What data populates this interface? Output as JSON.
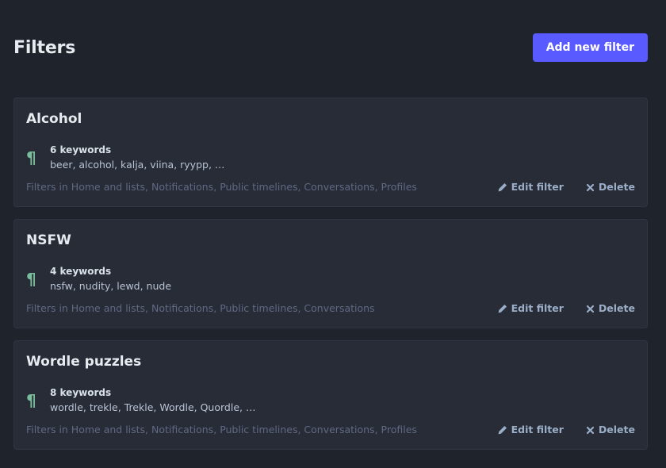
{
  "header": {
    "title": "Filters",
    "add_button_label": "Add new filter"
  },
  "filters": [
    {
      "title": "Alcohol",
      "keyword_count": "6 keywords",
      "keywords": "beer, alcohol, kalja, viina, ryypp, …",
      "contexts": "Filters in Home and lists, Notifications, Public timelines, Conversations, Profiles",
      "edit_label": "Edit filter",
      "delete_label": "Delete"
    },
    {
      "title": "NSFW",
      "keyword_count": "4 keywords",
      "keywords": "nsfw, nudity, lewd, nude",
      "contexts": "Filters in Home and lists, Notifications, Public timelines, Conversations",
      "edit_label": "Edit filter",
      "delete_label": "Delete"
    },
    {
      "title": "Wordle puzzles",
      "keyword_count": "8 keywords",
      "keywords": "wordle, trekle, Trekle, Wordle, Quordle, …",
      "contexts": "Filters in Home and lists, Notifications, Public timelines, Conversations, Profiles",
      "edit_label": "Edit filter",
      "delete_label": "Delete"
    }
  ],
  "icons": {
    "keyword": "paragraph-icon",
    "edit": "pencil-icon",
    "delete": "times-icon"
  },
  "colors": {
    "background": "#1f232b",
    "card": "#282c37",
    "accent": "#595aff",
    "keyword_icon": "#79bd9a",
    "muted": "#606984",
    "action": "#9baec8"
  }
}
